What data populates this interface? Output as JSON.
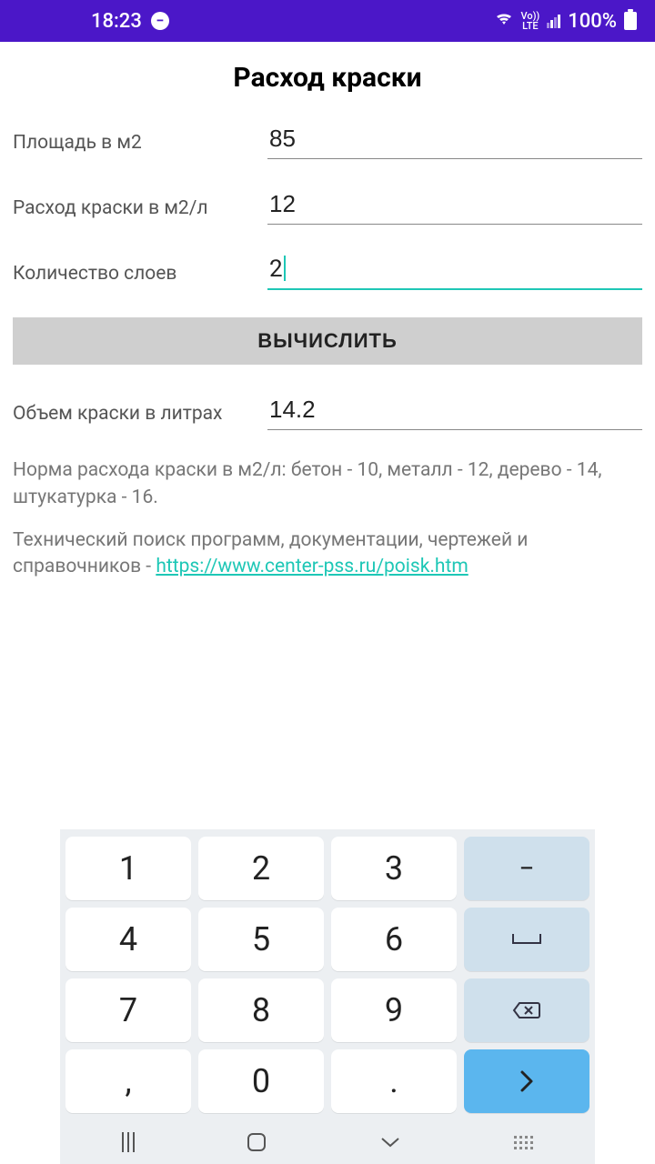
{
  "status": {
    "time": "18:23",
    "volte": "Vo))\nLTE",
    "battery_pct": "100%"
  },
  "title": "Расход краски",
  "fields": {
    "area": {
      "label": "Площадь в м2",
      "value": "85"
    },
    "rate": {
      "label": "Расход краски в м2/л",
      "value": "12"
    },
    "layers": {
      "label": "Количество слоев",
      "value": "2"
    },
    "result": {
      "label": "Объем краски в литрах",
      "value": "14.2"
    }
  },
  "button": {
    "calc": "ВЫЧИСЛИТЬ"
  },
  "notes": {
    "norms": "Норма расхода краски в м2/л: бетон - 10, металл - 12, дерево - 14, штукатурка - 16.",
    "search_prefix": "Технический поиск программ, документации, чертежей и справочников - ",
    "link": "https://www.center-pss.ru/poisk.htm"
  },
  "keypad": {
    "k1": "1",
    "k2": "2",
    "k3": "3",
    "minus": "−",
    "k4": "4",
    "k5": "5",
    "k6": "6",
    "space": "␣",
    "k7": "7",
    "k8": "8",
    "k9": "9",
    "comma": ",",
    "k0": "0",
    "dot": ".",
    "go": "›"
  }
}
